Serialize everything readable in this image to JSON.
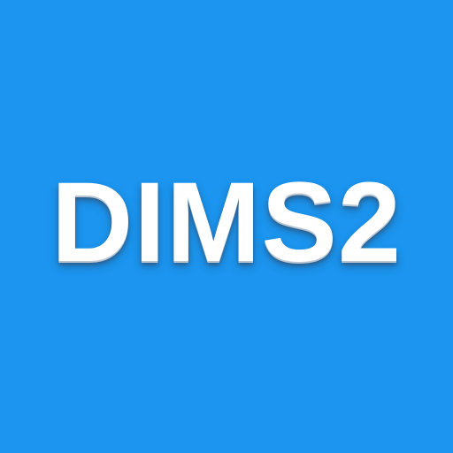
{
  "icon": {
    "label": "DIMS2",
    "background_color": "#1b95ef",
    "text_color": "#ffffff"
  }
}
